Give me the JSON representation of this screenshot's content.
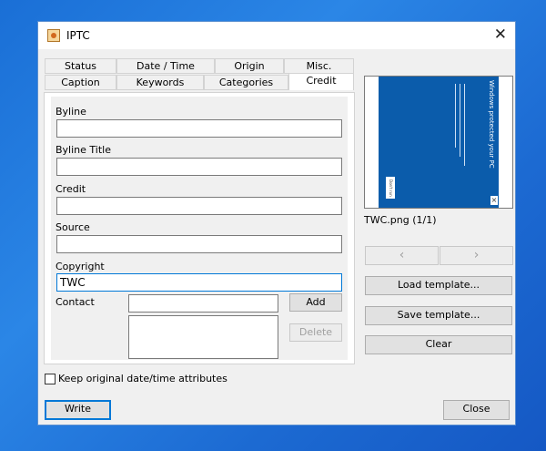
{
  "window": {
    "title": "IPTC",
    "close_glyph": "✕"
  },
  "tabs_row1": [
    "Status",
    "Date / Time",
    "Origin",
    "Misc."
  ],
  "tabs_row2": [
    "Caption",
    "Keywords",
    "Categories",
    "Credit"
  ],
  "fields": {
    "byline": {
      "label": "Byline",
      "value": ""
    },
    "byline_title": {
      "label": "Byline Title",
      "value": ""
    },
    "credit": {
      "label": "Credit",
      "value": ""
    },
    "source": {
      "label": "Source",
      "value": ""
    },
    "copyright": {
      "label": "Copyright",
      "value": "TWC"
    },
    "contact": {
      "label": "Contact",
      "value": ""
    }
  },
  "contact_buttons": {
    "add": "Add",
    "delete": "Delete"
  },
  "preview": {
    "caption": "TWC.png (1/1)",
    "image_text": "Windows protected your PC",
    "image_button": "Don't run",
    "prev_glyph": "‹",
    "next_glyph": "›"
  },
  "side_buttons": {
    "load_template": "Load template...",
    "save_template": "Save template...",
    "clear": "Clear"
  },
  "keep_attrs": {
    "label": "Keep original date/time attributes",
    "checked": false
  },
  "footer": {
    "write": "Write",
    "close": "Close"
  },
  "colors": {
    "desktop": "#1a6fd6",
    "accent": "#0078d7",
    "preview_bg": "#0b5cab"
  },
  "icons": {
    "app": "iptc-app-icon",
    "close": "close-icon"
  }
}
